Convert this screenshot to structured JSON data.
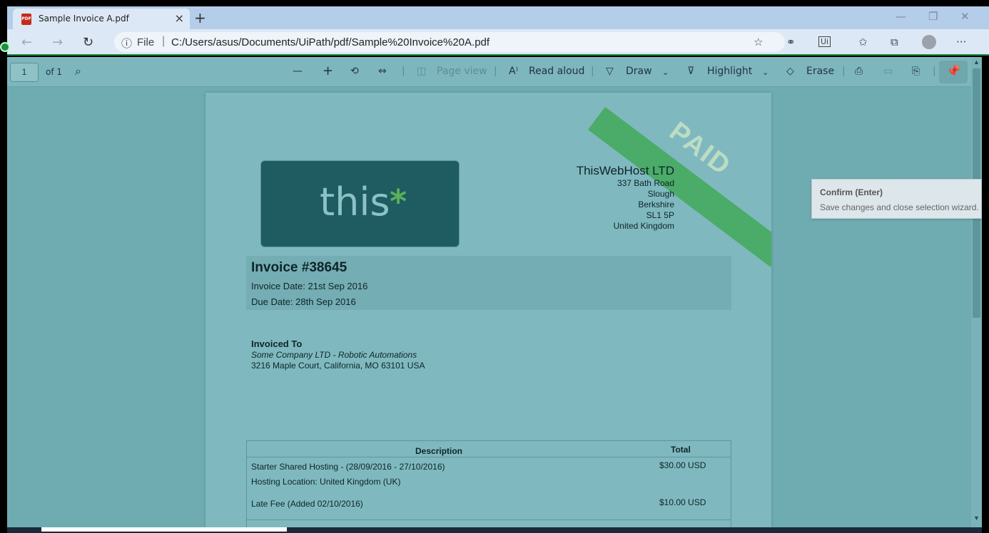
{
  "browser": {
    "tab_title": "Sample Invoice A.pdf",
    "tab_close": "×",
    "new_tab": "+",
    "url_prefix": "File",
    "url": "C:/Users/asus/Documents/UiPath/pdf/Sample%20Invoice%20A.pdf"
  },
  "pdf_toolbar": {
    "page_number": "1",
    "page_of": "of 1",
    "page_view": "Page view",
    "read_aloud": "Read aloud",
    "draw": "Draw",
    "highlight": "Highlight",
    "erase": "Erase"
  },
  "invoice": {
    "paid_stamp": "PAID",
    "logo_text": "this",
    "company_name": "ThisWebHost LTD",
    "address": [
      "337 Bath Road",
      "Slough",
      "Berkshire",
      "SL1 5P",
      "United Kingdom"
    ],
    "number": "Invoice #38645",
    "invoice_date": "Invoice Date: 21st Sep 2016",
    "due_date": "Due Date: 28th Sep 2016",
    "invoiced_to_title": "Invoiced To",
    "invoiced_to_company": "Some Company LTD - Robotic Automations",
    "invoiced_to_address": "3216 Maple Court,   California, MO 63101 USA",
    "table": {
      "headers": [
        "Description",
        "Total"
      ],
      "rows": [
        {
          "description": "Starter Shared Hosting - (28/09/2016 - 27/10/2016)",
          "total": "$30.00 USD"
        },
        {
          "description": "Hosting Location: United Kingdom (UK)",
          "total": ""
        },
        {
          "description": "Late Fee (Added 02/10/2016)",
          "total": "$10.00 USD"
        }
      ]
    }
  },
  "tooltip": {
    "title": "Confirm (Enter)",
    "description": "Save changes and close selection wizard."
  }
}
